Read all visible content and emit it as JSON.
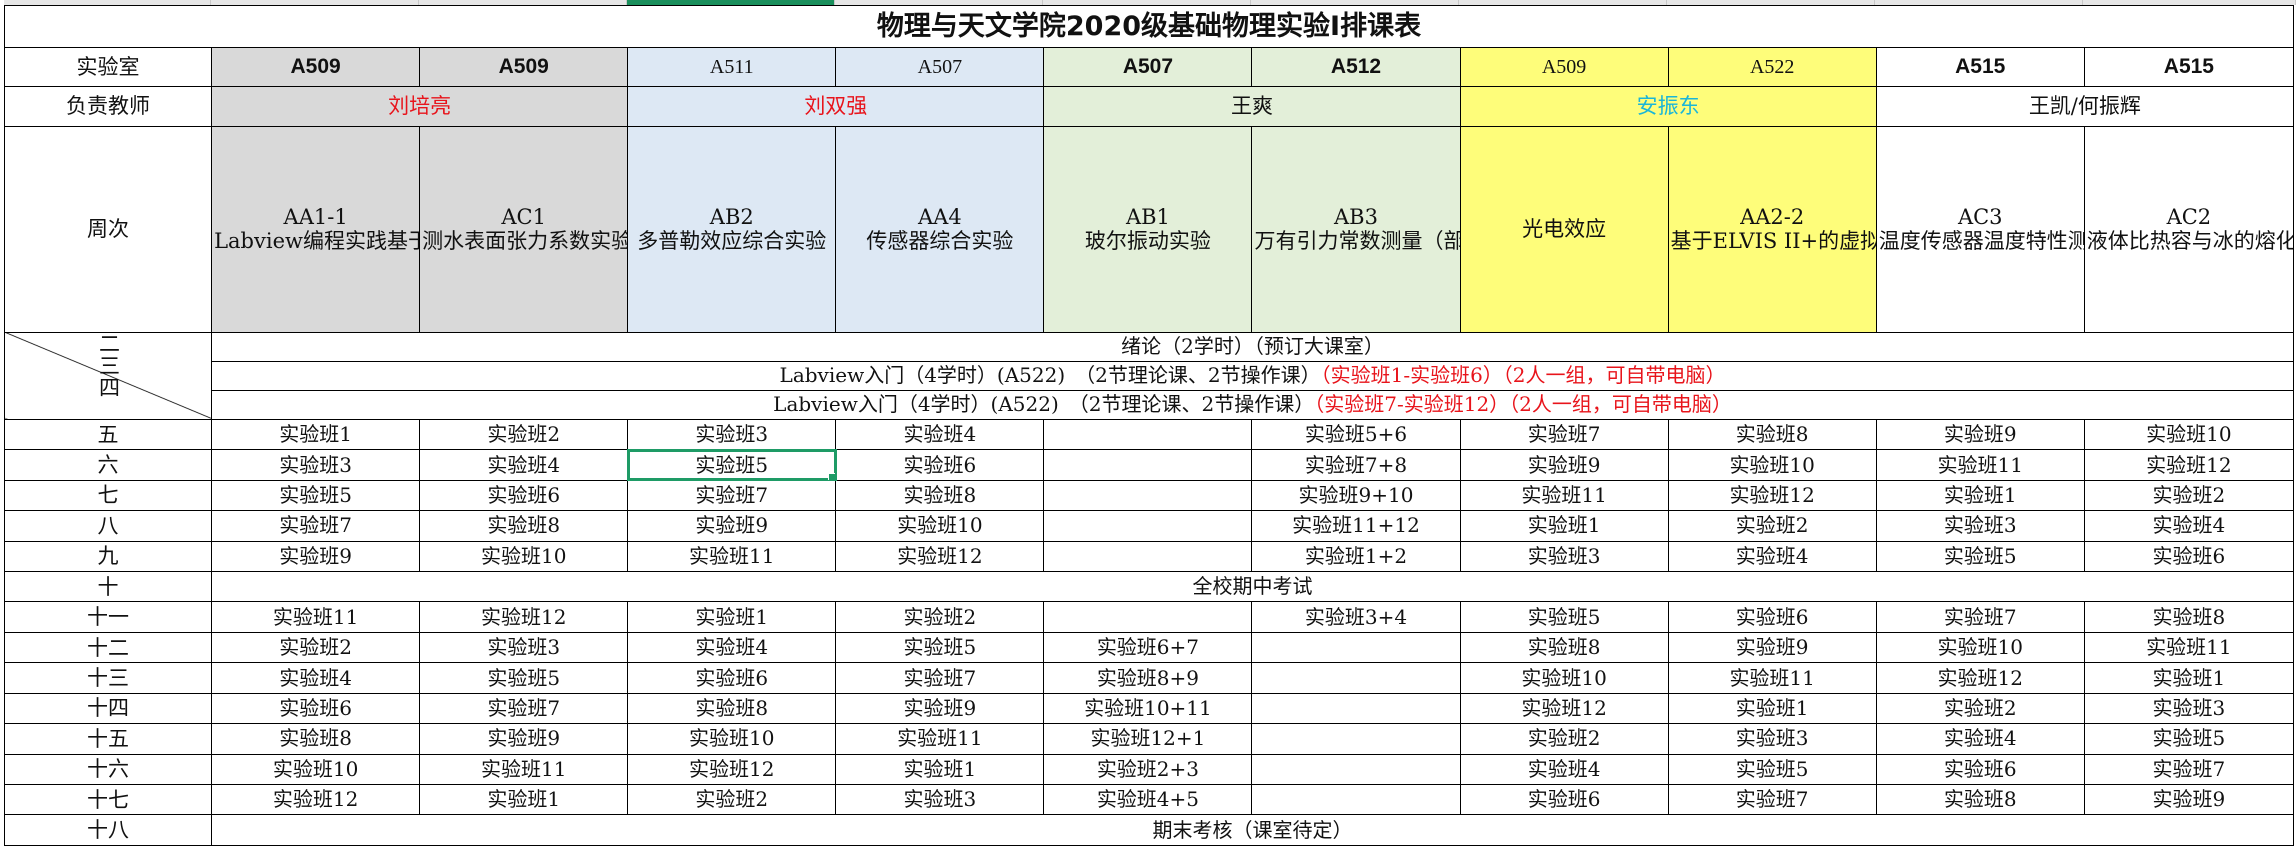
{
  "title": "物理与天文学院2020级基础物理实验I排课表",
  "labels": {
    "lab_room": "实验室",
    "teacher": "负责教师",
    "week": "周次"
  },
  "rooms": [
    "A509",
    "A509",
    "A511",
    "A507",
    "A507",
    "A512",
    "A509",
    "A522",
    "A515",
    "A515"
  ],
  "teachers": [
    "刘培亮",
    "刘双强",
    "王爽",
    "安振东",
    "王凯/何振辉"
  ],
  "experiments": [
    [
      "AA1-1",
      "Labview编程实践基于myDAQ的练习必做（应用于表面张力测量）"
    ],
    [
      "AC1",
      "测水表面张力系数实验"
    ],
    [
      "AB2",
      "多普勒效应综合实验"
    ],
    [
      "AA4",
      "传感器综合实验"
    ],
    [
      "AB1",
      "玻尔振动实验"
    ],
    [
      "AB3",
      "万有引力常数测量（部分同学两人一套仪器）"
    ],
    [
      "",
      "光电效应"
    ],
    [
      "AA2-2",
      "基于ELVIS II+的虚拟仪器实验（万用表、信号发生器）"
    ],
    [
      "AC3",
      "温度传感器温度特性测量"
    ],
    [
      "AC2",
      "液体比热容与冰的熔化热测量"
    ]
  ],
  "merged_rows": {
    "w2": {
      "week": "二",
      "text": "绪论（2学时）（预订大课室）"
    },
    "w3": {
      "week": "三",
      "text_a": "Labview入门（4学时）(A522)　（2节理论课、2节操作课）",
      "text_b": "（实验班1-实验班6）（2人一组，可自带电脑）"
    },
    "w4": {
      "week": "四",
      "text_a": "Labview入门（4学时）(A522)　（2节理论课、2节操作课）",
      "text_b": "（实验班7-实验班12）（2人一组，可自带电脑）"
    },
    "w10": {
      "week": "十",
      "text": "全校期中考试"
    },
    "w18": {
      "week": "十八",
      "text": "期末考核（课室待定）"
    }
  },
  "schedule": [
    {
      "week": "五",
      "cells": [
        "实验班1",
        "实验班2",
        "实验班3",
        "实验班4",
        "",
        "实验班5+6",
        "实验班7",
        "实验班8",
        "实验班9",
        "实验班10"
      ]
    },
    {
      "week": "六",
      "cells": [
        "实验班3",
        "实验班4",
        "实验班5",
        "实验班6",
        "",
        "实验班7+8",
        "实验班9",
        "实验班10",
        "实验班11",
        "实验班12"
      ]
    },
    {
      "week": "七",
      "cells": [
        "实验班5",
        "实验班6",
        "实验班7",
        "实验班8",
        "",
        "实验班9+10",
        "实验班11",
        "实验班12",
        "实验班1",
        "实验班2"
      ]
    },
    {
      "week": "八",
      "cells": [
        "实验班7",
        "实验班8",
        "实验班9",
        "实验班10",
        "",
        "实验班11+12",
        "实验班1",
        "实验班2",
        "实验班3",
        "实验班4"
      ]
    },
    {
      "week": "九",
      "cells": [
        "实验班9",
        "实验班10",
        "实验班11",
        "实验班12",
        "",
        "实验班1+2",
        "实验班3",
        "实验班4",
        "实验班5",
        "实验班6"
      ]
    },
    {
      "week": "十一",
      "cells": [
        "实验班11",
        "实验班12",
        "实验班1",
        "实验班2",
        "",
        "实验班3+4",
        "实验班5",
        "实验班6",
        "实验班7",
        "实验班8"
      ]
    },
    {
      "week": "十二",
      "cells": [
        "实验班2",
        "实验班3",
        "实验班4",
        "实验班5",
        "实验班6+7",
        "",
        "实验班8",
        "实验班9",
        "实验班10",
        "实验班11"
      ]
    },
    {
      "week": "十三",
      "cells": [
        "实验班4",
        "实验班5",
        "实验班6",
        "实验班7",
        "实验班8+9",
        "",
        "实验班10",
        "实验班11",
        "实验班12",
        "实验班1"
      ]
    },
    {
      "week": "十四",
      "cells": [
        "实验班6",
        "实验班7",
        "实验班8",
        "实验班9",
        "实验班10+11",
        "",
        "实验班12",
        "实验班1",
        "实验班2",
        "实验班3"
      ]
    },
    {
      "week": "十五",
      "cells": [
        "实验班8",
        "实验班9",
        "实验班10",
        "实验班11",
        "实验班12+1",
        "",
        "实验班2",
        "实验班3",
        "实验班4",
        "实验班5"
      ]
    },
    {
      "week": "十六",
      "cells": [
        "实验班10",
        "实验班11",
        "实验班12",
        "实验班1",
        "实验班2+3",
        "",
        "实验班4",
        "实验班5",
        "实验班6",
        "实验班7"
      ]
    },
    {
      "week": "十七",
      "cells": [
        "实验班12",
        "实验班1",
        "实验班2",
        "实验班3",
        "实验班4+5",
        "",
        "实验班6",
        "实验班7",
        "实验班8",
        "实验班9"
      ]
    }
  ],
  "colors": {
    "gray": "#d9d9d9",
    "blue": "#dde8f4",
    "green": "#e3efd9",
    "yellow": "#fefd7a",
    "red_text": "#e8141b",
    "cyan_text": "#1ab6d8",
    "selection": "#1e9b66"
  }
}
